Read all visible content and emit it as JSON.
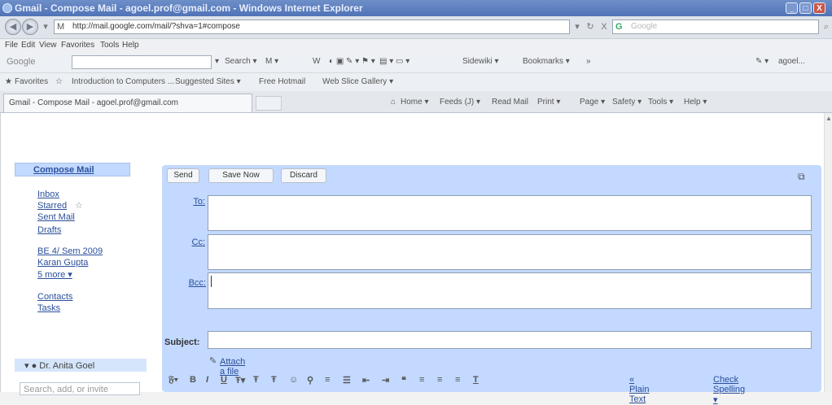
{
  "window": {
    "title": "Gmail - Compose Mail - agoel.prof@gmail.com - Windows Internet Explorer",
    "min": "_",
    "max": "□",
    "close": "X"
  },
  "address": {
    "url": "http://mail.google.com/mail/?shva=1#compose",
    "search_placeholder": "Google",
    "refresh": "↻",
    "stop": "X"
  },
  "menu": [
    "File",
    "Edit",
    "View",
    "Favorites",
    "Tools",
    "Help"
  ],
  "google_toolbar": {
    "logo": "Google",
    "search": "Search",
    "items": [
      "Search ▾",
      "M ▾",
      "W",
      "Sidewiki ▾",
      "Bookmarks ▾",
      "»",
      "agoel..."
    ]
  },
  "favorites": {
    "label": "Favorites",
    "items": [
      "Introduction to Computers ...",
      "Suggested Sites ▾",
      "Free Hotmail",
      "Web Slice Gallery ▾"
    ]
  },
  "tab": {
    "title": "Gmail - Compose Mail - agoel.prof@gmail.com"
  },
  "commands": [
    "Home ▾",
    "Feeds (J) ▾",
    "Read Mail",
    "Print ▾",
    "Page ▾",
    "Safety ▾",
    "Tools ▾",
    "Help ▾"
  ],
  "sidebar": {
    "compose": "Compose Mail",
    "items": [
      "Inbox",
      "Starred",
      "Sent Mail",
      "Drafts",
      "BE 4/ Sem 2009",
      "Karan Gupta",
      "5 more ▾",
      "Contacts",
      "Tasks"
    ],
    "chat_user": "Dr. Anita Goel",
    "chat_search": "Search, add, or invite"
  },
  "compose": {
    "send": "Send",
    "save_now": "Save Now",
    "discard": "Discard",
    "to_label": "To:",
    "cc_label": "Cc:",
    "bcc_label": "Bcc:",
    "subject_label": "Subject:",
    "attach": "Attach a file",
    "plain_text": "« Plain Text",
    "check_spelling": "Check Spelling ▾"
  }
}
